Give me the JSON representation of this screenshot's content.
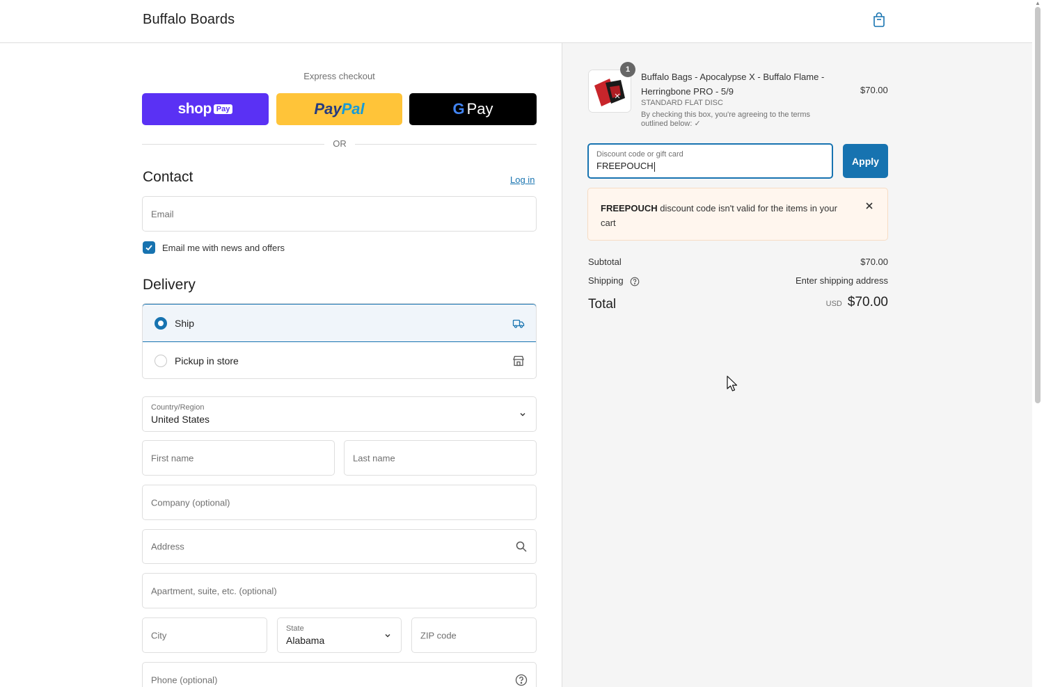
{
  "header": {
    "brand": "Buffalo Boards",
    "cart_icon": "shopping-bag-icon"
  },
  "express": {
    "title": "Express checkout",
    "shop_pay": {
      "word": "shop",
      "chip": "Pay"
    },
    "paypal": {
      "pay": "Pay",
      "pal": "Pal"
    },
    "gpay": {
      "g": "G",
      "pay": "Pay"
    },
    "or_text": "OR"
  },
  "contact": {
    "title": "Contact",
    "login_label": "Log in",
    "email_placeholder": "Email",
    "newsletter_label": "Email me with news and offers",
    "newsletter_checked": true
  },
  "delivery": {
    "title": "Delivery",
    "options": [
      {
        "label": "Ship",
        "selected": true,
        "icon": "truck-icon"
      },
      {
        "label": "Pickup in store",
        "selected": false,
        "icon": "store-icon"
      }
    ],
    "country_label": "Country/Region",
    "country_value": "United States",
    "first_name_placeholder": "First name",
    "last_name_placeholder": "Last name",
    "company_placeholder": "Company (optional)",
    "address_placeholder": "Address",
    "apartment_placeholder": "Apartment, suite, etc. (optional)",
    "city_placeholder": "City",
    "state_label": "State",
    "state_value": "Alabama",
    "zip_placeholder": "ZIP code",
    "phone_placeholder": "Phone (optional)"
  },
  "order": {
    "quantity": "1",
    "product_name": "Buffalo Bags - Apocalypse X - Buffalo Flame - Herringbone PRO - 5/9",
    "variant": "STANDARD FLAT DISC",
    "note": "By checking this box, you're agreeing to the terms outlined below: ✓",
    "price": "$70.00",
    "discount_label": "Discount code or gift card",
    "discount_value": "FREEPOUCH",
    "apply_label": "Apply",
    "error_code": "FREEPOUCH",
    "error_message": " discount code isn't valid for the items in your cart",
    "subtotal_label": "Subtotal",
    "subtotal_value": "$70.00",
    "shipping_label": "Shipping",
    "shipping_value": "Enter shipping address",
    "total_label": "Total",
    "currency": "USD",
    "total_value": "$70.00"
  },
  "colors": {
    "accent": "#1773b0",
    "shop_pay": "#5a31f4",
    "paypal": "#ffc439",
    "error_bg": "#fff6ee"
  }
}
